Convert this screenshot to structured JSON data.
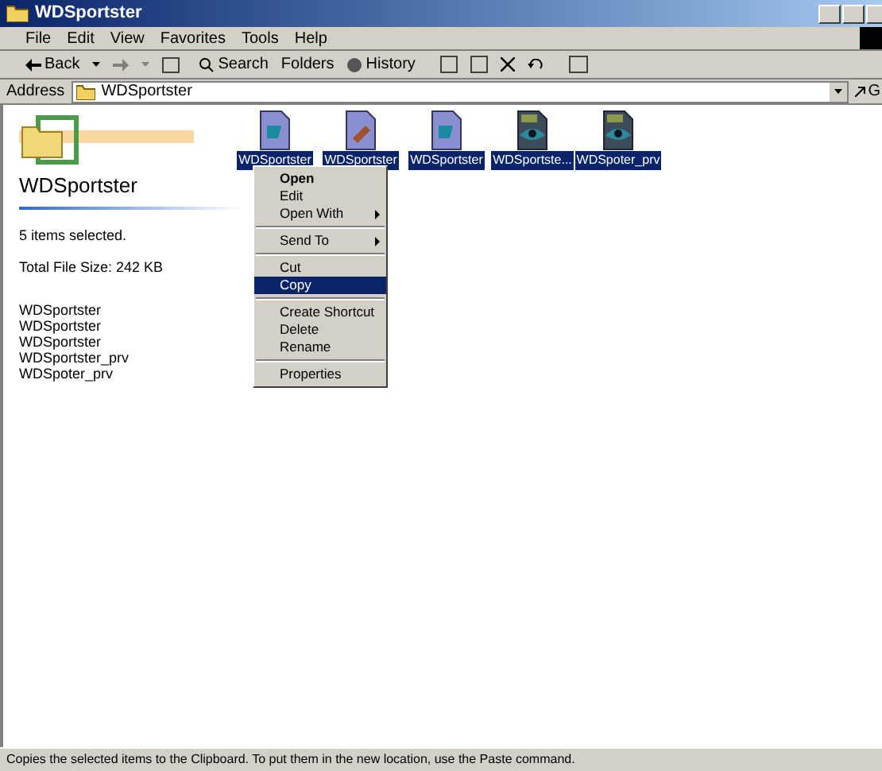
{
  "window": {
    "title": "WDSportster"
  },
  "menu_bar": [
    "File",
    "Edit",
    "View",
    "Favorites",
    "Tools",
    "Help"
  ],
  "toolbar": {
    "back": "Back",
    "search": "Search",
    "folders": "Folders",
    "history": "History"
  },
  "address": {
    "label": "Address",
    "value": "WDSportster",
    "go": "G"
  },
  "info_panel": {
    "title": "WDSportster",
    "selection": "5 items selected.",
    "size": "Total File Size: 242 KB",
    "files": [
      "WDSportster",
      "WDSportster",
      "WDSportster",
      "WDSportster_prv",
      "WDSpoter_prv"
    ]
  },
  "files": [
    {
      "name": "WDSportster",
      "kind": "document",
      "selected": true
    },
    {
      "name": "WDSportster",
      "kind": "drawing",
      "selected": true
    },
    {
      "name": "WDSportster",
      "kind": "document",
      "selected": true
    },
    {
      "name": "WDSportste...",
      "kind": "preview",
      "selected": true
    },
    {
      "name": "WDSpoter_prv",
      "kind": "preview",
      "selected": true
    }
  ],
  "context_menu": [
    {
      "label": "Open",
      "kind": "default",
      "selected": false
    },
    {
      "label": "Edit",
      "kind": "item",
      "selected": false
    },
    {
      "label": "Open With",
      "kind": "submenu",
      "selected": false
    },
    {
      "kind": "separator"
    },
    {
      "label": "Send To",
      "kind": "submenu",
      "selected": false
    },
    {
      "kind": "separator"
    },
    {
      "label": "Cut",
      "kind": "item",
      "selected": false
    },
    {
      "label": "Copy",
      "kind": "item",
      "selected": true
    },
    {
      "kind": "separator"
    },
    {
      "label": "Create Shortcut",
      "kind": "item",
      "selected": false
    },
    {
      "label": "Delete",
      "kind": "item",
      "selected": false
    },
    {
      "label": "Rename",
      "kind": "item",
      "selected": false
    },
    {
      "kind": "separator"
    },
    {
      "label": "Properties",
      "kind": "item",
      "selected": false
    }
  ],
  "status_bar": "Copies the selected items to the Clipboard. To put them in the new location, use the Paste command."
}
